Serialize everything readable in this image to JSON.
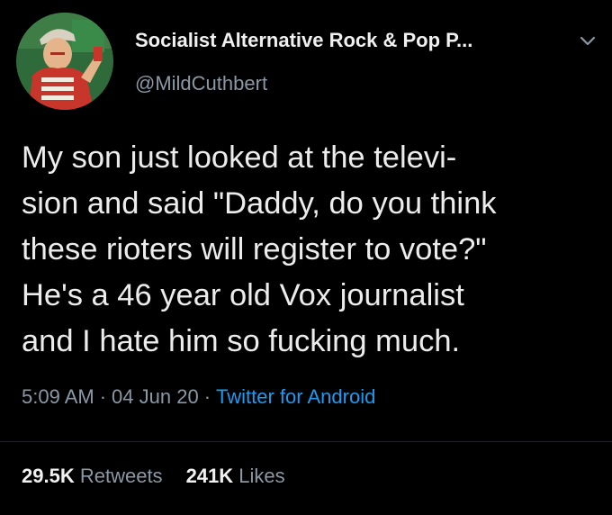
{
  "tweet": {
    "author": {
      "display_name": "Socialist Alternative Rock & Pop P...",
      "handle": "@MildCuthbert",
      "avatar_icon": "propaganda-poster-avatar"
    },
    "menu_icon": "chevron-down-icon",
    "text": "My son just looked at the televi-\nsion and said \"Daddy, do you think\nthese rioters will register to vote?\"\nHe's a 46 year old Vox journalist\nand I hate him so fucking much.",
    "time": "5:09 AM",
    "date": "04 Jun 20",
    "separator": "·",
    "source": "Twitter for Android",
    "retweets_count": "29.5K",
    "retweets_label": "Retweets",
    "likes_count": "241K",
    "likes_label": "Likes"
  },
  "colors": {
    "background": "#000000",
    "text_primary": "#ececec",
    "text_secondary": "#8b98a5",
    "link": "#1d9bf0"
  }
}
